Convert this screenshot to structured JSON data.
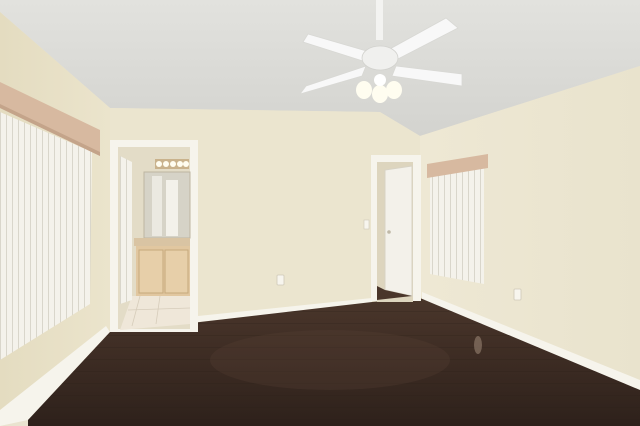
{
  "palette": {
    "ceiling": "#dcdcd8",
    "wall_left": "#e7e0c6",
    "wall_back": "#ebe5cf",
    "wall_right": "#ece6d1",
    "trim": "#f6f4ec",
    "floor": "#3b2a22",
    "floor_highlight": "#6b5547",
    "valance": "#d7b9a0",
    "blinds": "#f3f1ea",
    "cabinet": "#e1c7a0",
    "door": "#f3f1ea",
    "bath_wall": "#e3dcc7",
    "bath_floor": "#efe7d9",
    "fan": "#f8f8f8",
    "light": "#fffdf0"
  }
}
